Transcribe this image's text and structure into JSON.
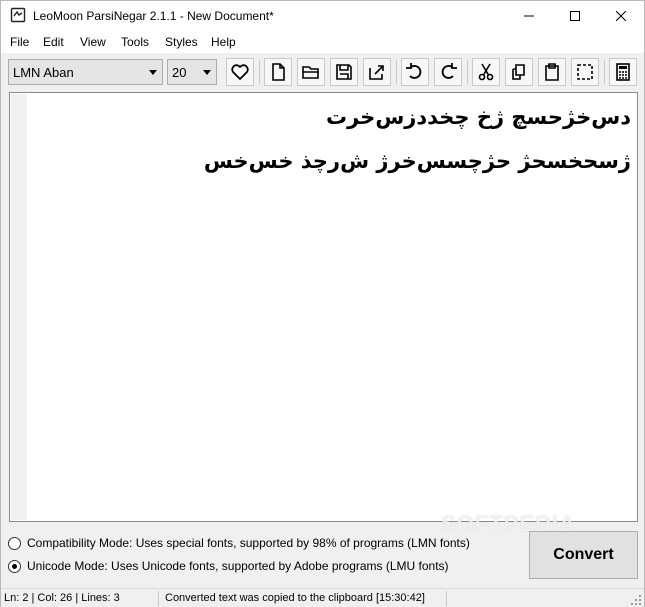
{
  "window": {
    "title": "LeoMoon ParsiNegar 2.1.1 - New Document*"
  },
  "menu": {
    "items": [
      "File",
      "Edit",
      "View",
      "Tools",
      "Styles",
      "Help"
    ]
  },
  "toolbar": {
    "font_name": "LMN Aban",
    "font_size": "20",
    "buttons": [
      "heart-icon",
      "new-document-icon",
      "open-folder-icon",
      "save-icon",
      "export-icon",
      "undo-icon",
      "redo-icon",
      "cut-icon",
      "copy-icon",
      "paste-icon",
      "select-all-icon",
      "calculator-icon"
    ]
  },
  "editor": {
    "lines": [
      "دس‌خژحسچ ژخ چخددزس‌خرت",
      "ژسحخسحژ حژچسس‌خرژ ش‌رچذ خس‌خس"
    ],
    "watermark": "SOFTPEDIA"
  },
  "modes": {
    "compatibility": "Compatibility Mode: Uses special fonts, supported by 98% of programs (LMN fonts)",
    "unicode": "Unicode Mode: Uses Unicode fonts, supported by Adobe programs (LMU fonts)",
    "selected": "unicode"
  },
  "convert_label": "Convert",
  "status": {
    "position": "Ln: 2 | Col: 26 | Lines: 3",
    "message": "Converted text was copied to the clipboard [15:30:42]"
  }
}
